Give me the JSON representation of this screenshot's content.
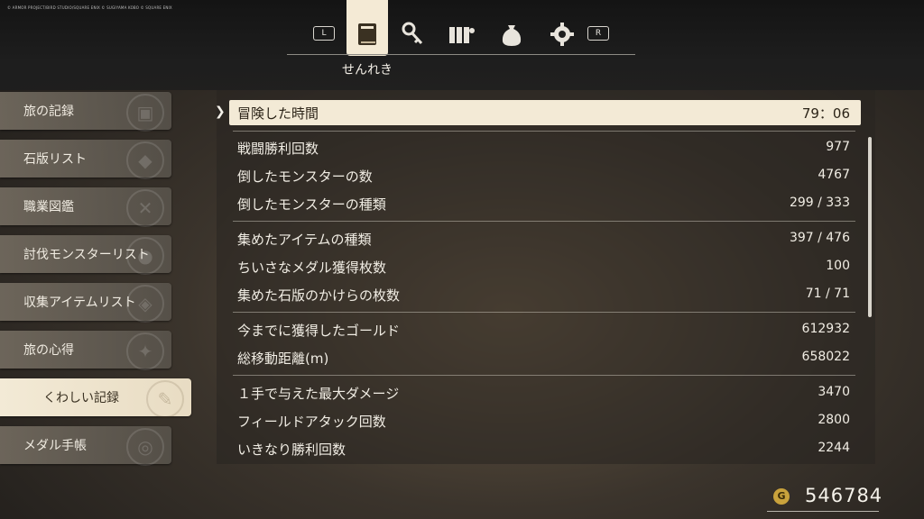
{
  "copyright": "© ARMOR PROJECT/BIRD STUDIO/SQUARE ENIX © SUGIYAMA KOBO © SQUARE ENIX",
  "tabs": {
    "left_button": "L",
    "right_button": "R",
    "active_caption": "せんれき",
    "icons": [
      "book-icon",
      "key-icon",
      "party-icon",
      "bag-icon",
      "gear-icon"
    ]
  },
  "sidebar": {
    "items": [
      {
        "label": "旅の記録",
        "icon": "book-icon"
      },
      {
        "label": "石版リスト",
        "icon": "tablet-icon"
      },
      {
        "label": "職業図鑑",
        "icon": "tools-icon"
      },
      {
        "label": "討伐モンスターリスト",
        "icon": "monster-icon"
      },
      {
        "label": "収集アイテムリスト",
        "icon": "item-icon"
      },
      {
        "label": "旅の心得",
        "icon": "tips-icon"
      },
      {
        "label": "くわしい記録",
        "icon": "quill-icon"
      },
      {
        "label": "メダル手帳",
        "icon": "medal-icon"
      }
    ],
    "active_index": 6
  },
  "records": [
    {
      "label": "冒険した時間",
      "value": "79：06"
    },
    {
      "label": "戦闘勝利回数",
      "value": "977"
    },
    {
      "label": "倒したモンスターの数",
      "value": "4767"
    },
    {
      "label": "倒したモンスターの種類",
      "value": "299 / 333"
    },
    {
      "label": "集めたアイテムの種類",
      "value": "397 / 476"
    },
    {
      "label": "ちいさなメダル獲得枚数",
      "value": "100"
    },
    {
      "label": "集めた石版のかけらの枚数",
      "value": "71 / 71"
    },
    {
      "label": "今までに獲得したゴールド",
      "value": "612932"
    },
    {
      "label": "総移動距離(m)",
      "value": "658022"
    },
    {
      "label": "１手で与えた最大ダメージ",
      "value": "3470"
    },
    {
      "label": "フィールドアタック回数",
      "value": "2800"
    },
    {
      "label": "いきなり勝利回数",
      "value": "2244"
    }
  ],
  "gold": {
    "symbol": "G",
    "value": "546784"
  },
  "colors": {
    "accent": "#f3ead6",
    "gold": "#c9a23c"
  }
}
